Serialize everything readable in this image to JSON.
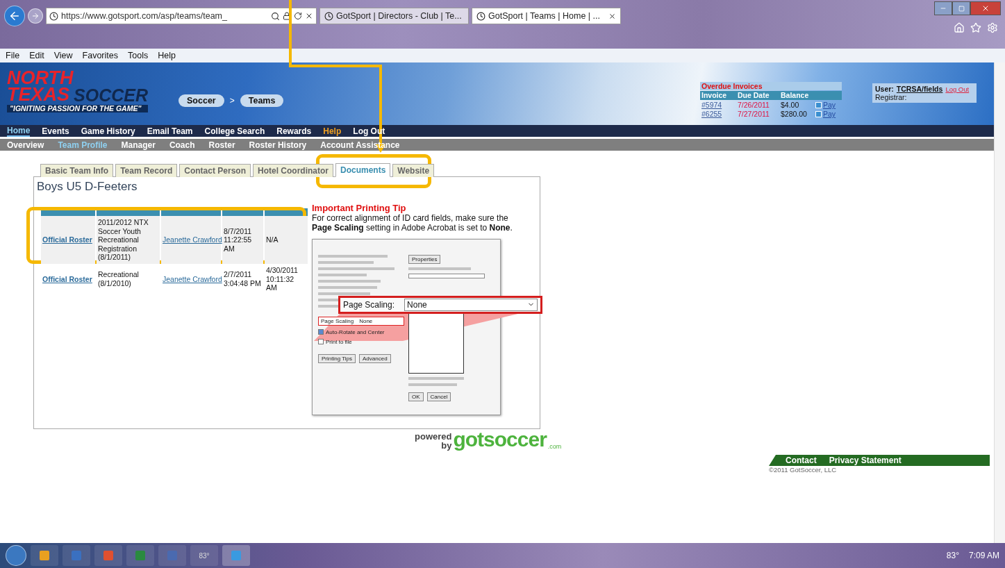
{
  "browser": {
    "address": "https://www.gotsport.com/asp/teams/team_",
    "tabs": [
      {
        "title": "GotSport | Directors - Club | Te...",
        "selected": false
      },
      {
        "title": "GotSport | Teams | Home | ...",
        "selected": true
      }
    ],
    "menu": [
      "File",
      "Edit",
      "View",
      "Favorites",
      "Tools",
      "Help"
    ]
  },
  "header": {
    "logo": {
      "line1": "NORTH",
      "line2": "TEXAS",
      "line3": "SOCCER",
      "tagline": "\"IGNITING PASSION FOR THE GAME\""
    },
    "breadcrumb": [
      "Soccer",
      "Teams"
    ],
    "breadcrumb_separator": ">",
    "invoices": {
      "title": "Overdue Invoices",
      "columns": [
        "Invoice",
        "Due Date",
        "Balance"
      ],
      "rows": [
        {
          "invoice": "#5974",
          "due": "7/26/2011",
          "balance": "$4.00",
          "action": "Pay"
        },
        {
          "invoice": "#6255",
          "due": "7/27/2011",
          "balance": "$280.00",
          "action": "Pay"
        }
      ]
    },
    "user": {
      "label": "User:",
      "name": "TCRSA/fields",
      "logout": "Log Out",
      "role": "Registrar:"
    }
  },
  "nav": [
    {
      "label": "Home",
      "selected": true,
      "kind": "link"
    },
    {
      "label": "Events",
      "selected": false,
      "kind": "link"
    },
    {
      "label": "Game History",
      "selected": false,
      "kind": "link"
    },
    {
      "label": "Email Team",
      "selected": false,
      "kind": "link"
    },
    {
      "label": "College Search",
      "selected": false,
      "kind": "link"
    },
    {
      "label": "Rewards",
      "selected": false,
      "kind": "link"
    },
    {
      "label": "Help",
      "selected": false,
      "kind": "accent"
    },
    {
      "label": "Log Out",
      "selected": false,
      "kind": "link"
    }
  ],
  "subnav": [
    {
      "label": "Overview",
      "selected": false
    },
    {
      "label": "Team Profile",
      "selected": true
    },
    {
      "label": "Manager",
      "selected": false
    },
    {
      "label": "Coach",
      "selected": false
    },
    {
      "label": "Roster",
      "selected": false
    },
    {
      "label": "Roster History",
      "selected": false
    },
    {
      "label": "Account Assistance",
      "selected": false
    }
  ],
  "tabs": [
    {
      "label": "Basic Team Info",
      "selected": false
    },
    {
      "label": "Team Record",
      "selected": false
    },
    {
      "label": "Contact Person",
      "selected": false
    },
    {
      "label": "Hotel Coordinator",
      "selected": false
    },
    {
      "label": "Documents",
      "selected": true
    },
    {
      "label": "Website",
      "selected": false
    }
  ],
  "team_name": "Boys U5 D-Feeters",
  "documents": {
    "rows": [
      {
        "document": "Official Roster",
        "event": "2011/2012 NTX Soccer Youth Recreational Registration (8/1/2011)",
        "owner": "Jeanette Crawford",
        "created": "8/7/2011 11:22:55 AM",
        "expires": "N/A"
      },
      {
        "document": "Official Roster",
        "event": "Recreational (8/1/2010)",
        "owner": "Jeanette Crawford",
        "created": "2/7/2011 3:04:48 PM",
        "expires": "4/30/2011 10:11:32 AM"
      }
    ]
  },
  "tip": {
    "title": "Important Printing Tip",
    "text": "For correct alignment of ID card fields, make sure the **Page Scaling** setting in Adobe Acrobat is set to **None**."
  },
  "dialog": {
    "properties": "Properties",
    "scaling_label": "Page Scaling",
    "scaling_value": "None",
    "options": [
      {
        "label": "Auto-Rotate and Center",
        "checked": true
      },
      {
        "label": "Print to file",
        "checked": false
      }
    ],
    "buttons_left": [
      "Printing Tips",
      "Advanced"
    ],
    "buttons_right": [
      "OK",
      "Cancel"
    ],
    "callout_label": "Page Scaling:",
    "callout_value": "None"
  },
  "powered": {
    "prefix": "powered",
    "by": "by",
    "brand": "gotsoccer",
    "suffix": ".com"
  },
  "footer": {
    "links": [
      "Contact",
      "Privacy Statement"
    ],
    "copyright": "©2011 GotSoccer, LLC"
  },
  "taskbar": {
    "weather": "83°",
    "tray_temp": "83°",
    "time": "7:09 AM"
  }
}
